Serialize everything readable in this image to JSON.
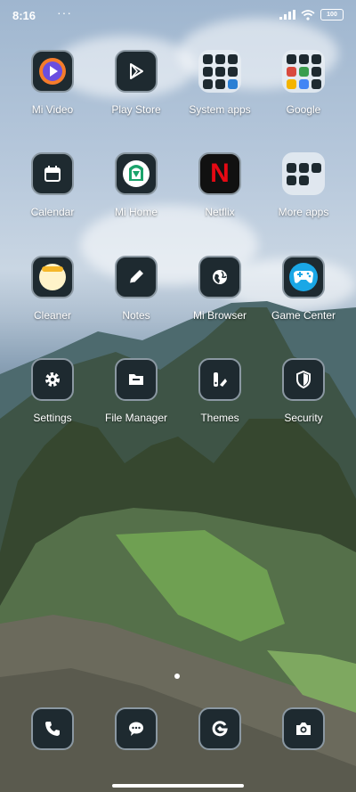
{
  "status_bar": {
    "time": "8:16",
    "dots": "···",
    "battery": "100"
  },
  "apps": [
    {
      "label": "Mi Video",
      "icon": "play-circle-icon"
    },
    {
      "label": "Play Store",
      "icon": "play-store-icon"
    },
    {
      "label": "System apps",
      "icon": "folder-icon"
    },
    {
      "label": "Google",
      "icon": "folder-icon"
    },
    {
      "label": "Calendar",
      "icon": "calendar-icon"
    },
    {
      "label": "Mi Home",
      "icon": "home-icon"
    },
    {
      "label": "Netflix",
      "icon": "netflix-icon"
    },
    {
      "label": "More apps",
      "icon": "folder-icon"
    },
    {
      "label": "Cleaner",
      "icon": "cleaner-icon"
    },
    {
      "label": "Notes",
      "icon": "pencil-icon"
    },
    {
      "label": "Mi Browser",
      "icon": "globe-icon"
    },
    {
      "label": "Game Center",
      "icon": "gamepad-icon"
    },
    {
      "label": "Settings",
      "icon": "gear-icon"
    },
    {
      "label": "File Manager",
      "icon": "folder-file-icon"
    },
    {
      "label": "Themes",
      "icon": "themes-icon"
    },
    {
      "label": "Security",
      "icon": "shield-icon"
    }
  ],
  "dock": [
    {
      "icon": "phone-icon"
    },
    {
      "icon": "message-icon"
    },
    {
      "icon": "browser-g-icon"
    },
    {
      "icon": "camera-icon"
    }
  ],
  "netflix_letter": "N"
}
